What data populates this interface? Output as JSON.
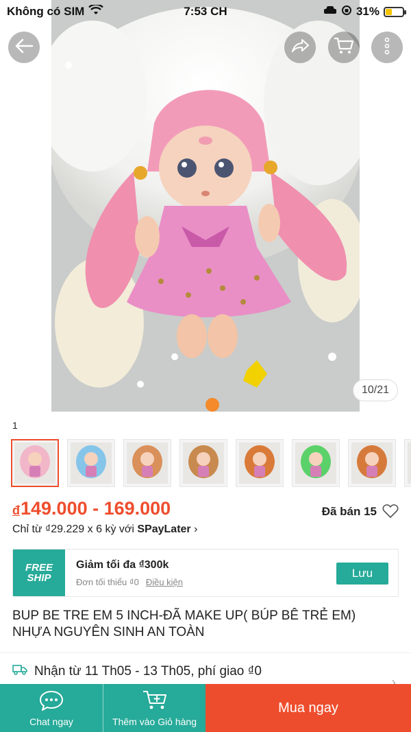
{
  "status_bar": {
    "carrier": "Không có SIM",
    "time": "7:53 CH",
    "battery": "31%"
  },
  "gallery": {
    "counter": "10/21",
    "selected_variant": "1",
    "thumbnail_count": 8,
    "thumb_colors": [
      "#f2b6c9",
      "#86c5ea",
      "#d9905a",
      "#c88a4e",
      "#d97a38",
      "#5bd16a",
      "#d67a3c",
      "#d67a3c"
    ]
  },
  "product": {
    "currency_symbol": "đ",
    "price_range": "149.000 - 169.000",
    "sold": "Đã bán 15",
    "paylater_prefix": "Chỉ từ ₫29.229 x 6 kỳ với ",
    "paylater_brand": "SPayLater",
    "paylater_chevron": "›",
    "title": "BUP BE TRE EM 5 INCH-ĐÃ MAKE UP( BÚP BÊ TRẺ EM) NHỰA NGUYÊN SINH AN TOÀN"
  },
  "voucher": {
    "badge_line1": "FREE",
    "badge_line2": "SHIP",
    "title": "Giảm tối đa ₫300k",
    "min_order": "Đơn tối thiểu ₫0",
    "terms_link": "Điều kiện",
    "save_label": "Lưu"
  },
  "shipping": {
    "text": "Nhận từ 11 Th05 - 13 Th05, phí giao ₫0",
    "chevron": "›"
  },
  "bottom_bar": {
    "chat_label": "Chat ngay",
    "add_to_cart_label": "Thêm vào Giỏ hàng",
    "buy_now_label": "Mua ngay"
  },
  "colors": {
    "accent_orange": "#ee4d2d",
    "accent_teal": "#26aa99"
  }
}
